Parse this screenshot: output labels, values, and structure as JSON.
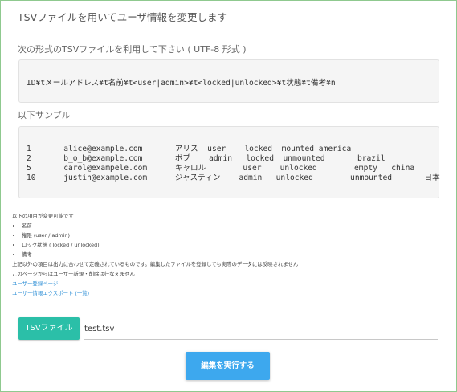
{
  "page": {
    "title": "TSVファイルを用いてユーザ情報を変更します"
  },
  "format": {
    "label": "次の形式のTSVファイルを利用して下さい ( UTF-8 形式 )",
    "line": "ID¥tメールアドレス¥t名前¥t<user|admin>¥t<locked|unlocked>¥t状態¥t備考¥n"
  },
  "sample": {
    "label": "以下サンプル",
    "rows": [
      "1       alice@example.com       アリス  user    locked  mounted america",
      "2       b_o_b@example.com       ボブ    admin   locked  unmounted       brazil",
      "5       carol@exampele.com      キャロル        user    unlocked        empty   china",
      "10      justin@example.com      ジャスティン    admin   unlocked        unmounted       日本"
    ]
  },
  "notes": {
    "intro": "以下の項目が変更可能です",
    "items": [
      "名前",
      "権限 (user / admin)",
      "ロック状態 ( locked / unlocked)",
      "備考"
    ],
    "line1": "上記以外の項目は出力に合わせて定義されているものです。編集したファイルを登録しても実際のデータには反映されません",
    "line2": "このページからはユーザー新規・削除は行なえません",
    "links": [
      "ユーザー登録ページ",
      "ユーザー情報エクスポート (一覧)"
    ]
  },
  "upload": {
    "button_label": "TSVファイル",
    "file_name": "test.tsv"
  },
  "submit": {
    "label": "編集を実行する"
  },
  "colors": {
    "frame_border": "#8fc98f",
    "file_button": "#2bbfa8",
    "submit_button": "#3da8ee",
    "link": "#2e8fd6"
  }
}
